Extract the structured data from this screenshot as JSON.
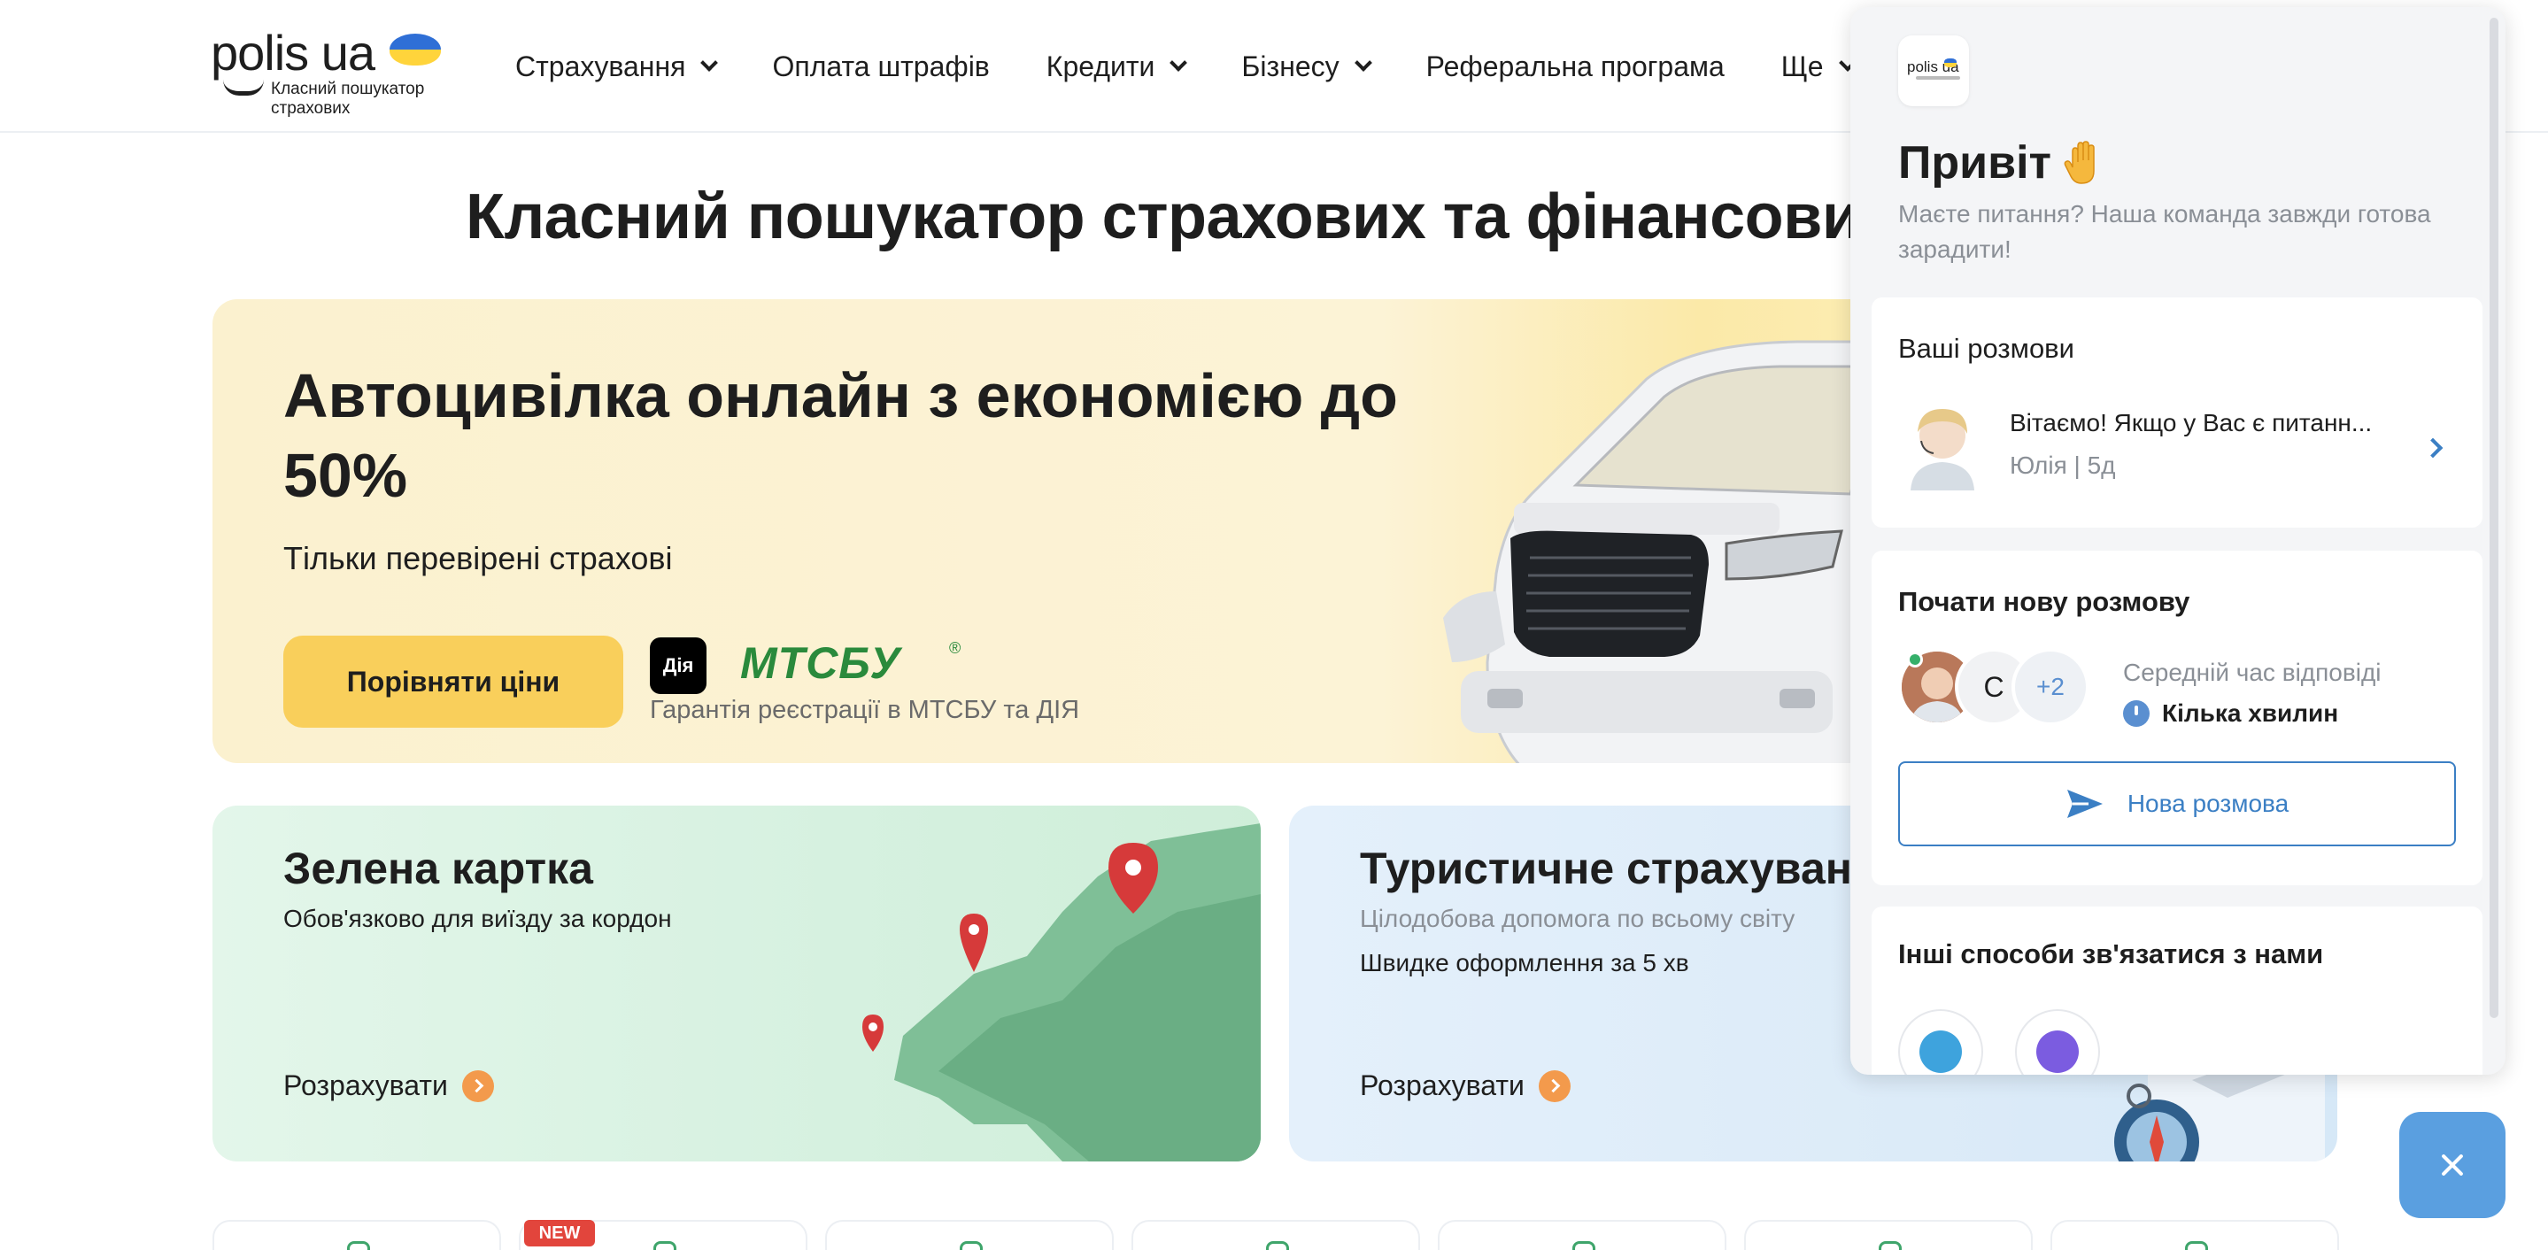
{
  "header": {
    "logo": {
      "word": "polis ua",
      "tagline": "Класний пошукатор страхових"
    },
    "nav": [
      {
        "label": "Страхування",
        "dropdown": true
      },
      {
        "label": "Оплата штрафів",
        "dropdown": false
      },
      {
        "label": "Кредити",
        "dropdown": true
      },
      {
        "label": "Бізнесу",
        "dropdown": true
      },
      {
        "label": "Реферальна програма",
        "dropdown": false
      },
      {
        "label": "Ще",
        "dropdown": true
      }
    ]
  },
  "main": {
    "page_title": "Класний пошукатор страхових та фінансових пр",
    "hero": {
      "title": "Автоцивілка онлайн з економією до 50%",
      "subtitle": "Тільки перевірені страхові",
      "cta_label": "Порівняти ціни",
      "diia_label": "Дія",
      "mtsbu_label": "МТСБУ",
      "mtsbu_mark": "®",
      "guarantee": "Гарантія реєстрації в МТСБУ та ДІЯ"
    },
    "cards": [
      {
        "title": "Зелена картка",
        "subtitle": "Обов'язково для виїзду за кордон",
        "link_label": "Розрахувати"
      },
      {
        "title": "Туристичне страхування",
        "subtitle": "Цілодобова допомога по всьому світу",
        "subtitle2": "Швидке оформлення за 5 хв",
        "link_label": "Розрахувати"
      }
    ],
    "strip": {
      "new_badge": "NEW"
    }
  },
  "chat_widget": {
    "logo_text": "polis ua",
    "greeting": "Привіт",
    "intro": "Маєте питання? Наша команда завжди готова зарадити!",
    "conversations": {
      "title": "Ваші розмови",
      "items": [
        {
          "message": "Вітаємо! Якщо у Вас є питанн...",
          "meta": "Юлія | 5д"
        }
      ]
    },
    "new_conversation": {
      "title": "Почати нову розмову",
      "avatar_letter": "С",
      "extra_count": "+2",
      "response_label": "Середній час відповіді",
      "response_value": "Кілька хвилин",
      "button_label": "Нова розмова"
    },
    "other_ways": {
      "title": "Інші способи зв'язатися з нами"
    },
    "colors": {
      "accent": "#3b7fc4",
      "online": "#35b06a",
      "cta": "#f9cf5b"
    }
  }
}
